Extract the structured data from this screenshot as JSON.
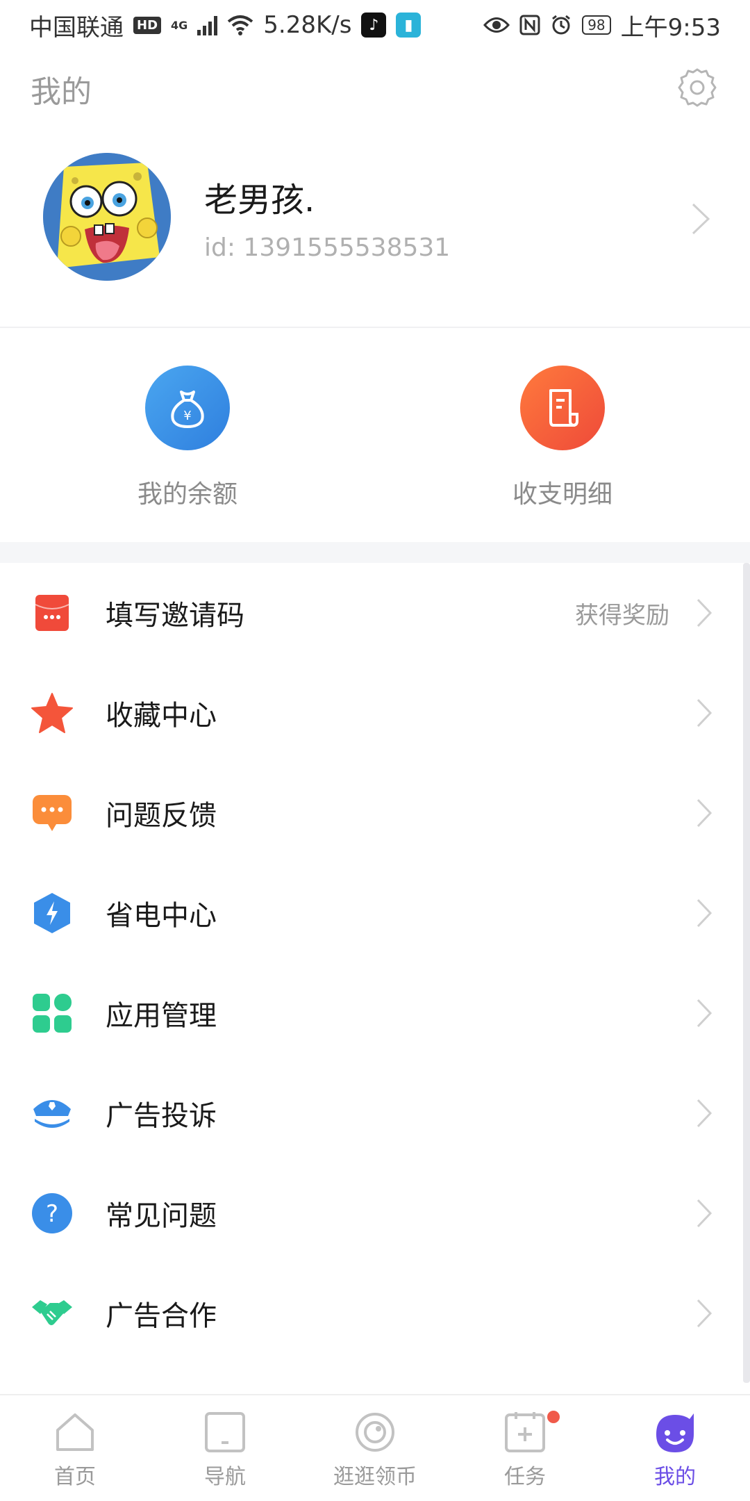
{
  "status_bar": {
    "carrier": "中国联通",
    "hd": "HD",
    "network": "4G",
    "speed": "5.28K/s",
    "battery": "98",
    "time": "上午9:53",
    "icons": [
      "tiktok-icon",
      "reader-icon",
      "eye-icon",
      "nfc-icon",
      "alarm-icon"
    ]
  },
  "header": {
    "title": "我的",
    "settings_icon": "gear-icon"
  },
  "profile": {
    "nickname": "老男孩.",
    "user_id": "id: 1391555538531"
  },
  "wallet": [
    {
      "label": "我的余额",
      "icon": "money-bag-icon",
      "color": "#3d8ee8"
    },
    {
      "label": "收支明细",
      "icon": "bill-icon",
      "color": "#f25a3c"
    }
  ],
  "menu": [
    {
      "label": "填写邀请码",
      "extra": "获得奖励",
      "icon": "red-envelope-icon"
    },
    {
      "label": "收藏中心",
      "extra": "",
      "icon": "star-icon"
    },
    {
      "label": "问题反馈",
      "extra": "",
      "icon": "chat-bubble-icon"
    },
    {
      "label": "省电中心",
      "extra": "",
      "icon": "lightning-shield-icon"
    },
    {
      "label": "应用管理",
      "extra": "",
      "icon": "app-grid-icon"
    },
    {
      "label": "广告投诉",
      "extra": "",
      "icon": "police-cap-icon"
    },
    {
      "label": "常见问题",
      "extra": "",
      "icon": "question-icon"
    },
    {
      "label": "广告合作",
      "extra": "",
      "icon": "handshake-icon"
    }
  ],
  "bottom_nav": [
    {
      "label": "首页",
      "icon": "home-icon",
      "active": false
    },
    {
      "label": "导航",
      "icon": "tablet-icon",
      "active": false
    },
    {
      "label": "逛逛领币",
      "icon": "eye-icon",
      "active": false
    },
    {
      "label": "任务",
      "icon": "calendar-plus-icon",
      "active": false,
      "badge": true
    },
    {
      "label": "我的",
      "icon": "smiley-icon",
      "active": true
    }
  ],
  "colors": {
    "accent": "#6b4ee6",
    "balance_blue": "#3d8ee8",
    "detail_orange": "#f25a3c"
  }
}
